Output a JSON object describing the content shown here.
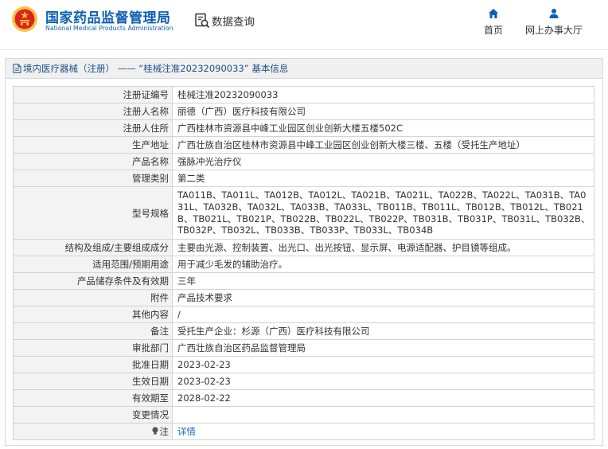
{
  "header": {
    "brand_cn": "国家药品监督管理局",
    "brand_en": "National Medical Products Administration",
    "search_label": "数据查询",
    "nav": [
      {
        "label": "首页",
        "icon": "home-icon"
      },
      {
        "label": "网上办事大厅",
        "icon": "user-icon"
      }
    ]
  },
  "panel": {
    "title": "境内医疗器械（注册） —— “桂械注准20232090033” 基本信息"
  },
  "details": [
    {
      "label": "注册证编号",
      "value": "桂械注准20232090033"
    },
    {
      "label": "注册人名称",
      "value": "丽德（广西）医疗科技有限公司"
    },
    {
      "label": "注册人住所",
      "value": "广西桂林市资源县中峰工业园区创业创新大楼五楼502C"
    },
    {
      "label": "生产地址",
      "value": "广西壮族自治区桂林市资源县中峰工业园区创业创新大楼三楼、五楼（受托生产地址）"
    },
    {
      "label": "产品名称",
      "value": "强脉冲光治疗仪"
    },
    {
      "label": "管理类别",
      "value": "第二类"
    },
    {
      "label": "型号规格",
      "value": "TA011B、TA011L、TA012B、TA012L、TA021B、TA021L、TA022B、TA022L、TA031B、TA031L、TA032B、TA032L、TA033B、TA033L、TB011B、TB011L、TB012B、TB012L、TB021B、TB021L、TB021P、TB022B、TB022L、TB022P、TB031B、TB031P、TB031L、TB032B、TB032P、TB032L、TB033B、TB033P、TB033L、TB034B"
    },
    {
      "label": "结构及组成/主要组成成分",
      "value": "主要由光源、控制装置、出光口、出光按钮、显示屏、电源适配器、护目镜等组成。"
    },
    {
      "label": "适用范围/预期用途",
      "value": "用于减少毛发的辅助治疗。"
    },
    {
      "label": "产品储存条件及有效期",
      "value": "三年"
    },
    {
      "label": "附件",
      "value": "产品技术要求"
    },
    {
      "label": "其他内容",
      "value": "/"
    },
    {
      "label": "备注",
      "value": "受托生产企业：杉源（广西）医疗科技有限公司"
    },
    {
      "label": "审批部门",
      "value": "广西壮族自治区药品监督管理局"
    },
    {
      "label": "批准日期",
      "value": "2023-02-23"
    },
    {
      "label": "生效日期",
      "value": "2023-02-23"
    },
    {
      "label": "有效期至",
      "value": "2028-02-22"
    },
    {
      "label": "变更情况",
      "value": ""
    },
    {
      "label": "注",
      "value": "详情"
    }
  ],
  "colors": {
    "brand_blue": "#0f5fb3",
    "link_blue": "#1c6cb8",
    "label_bg": "#f3f3f3",
    "emblem_red": "#d7261e",
    "emblem_gold": "#f6c343"
  }
}
